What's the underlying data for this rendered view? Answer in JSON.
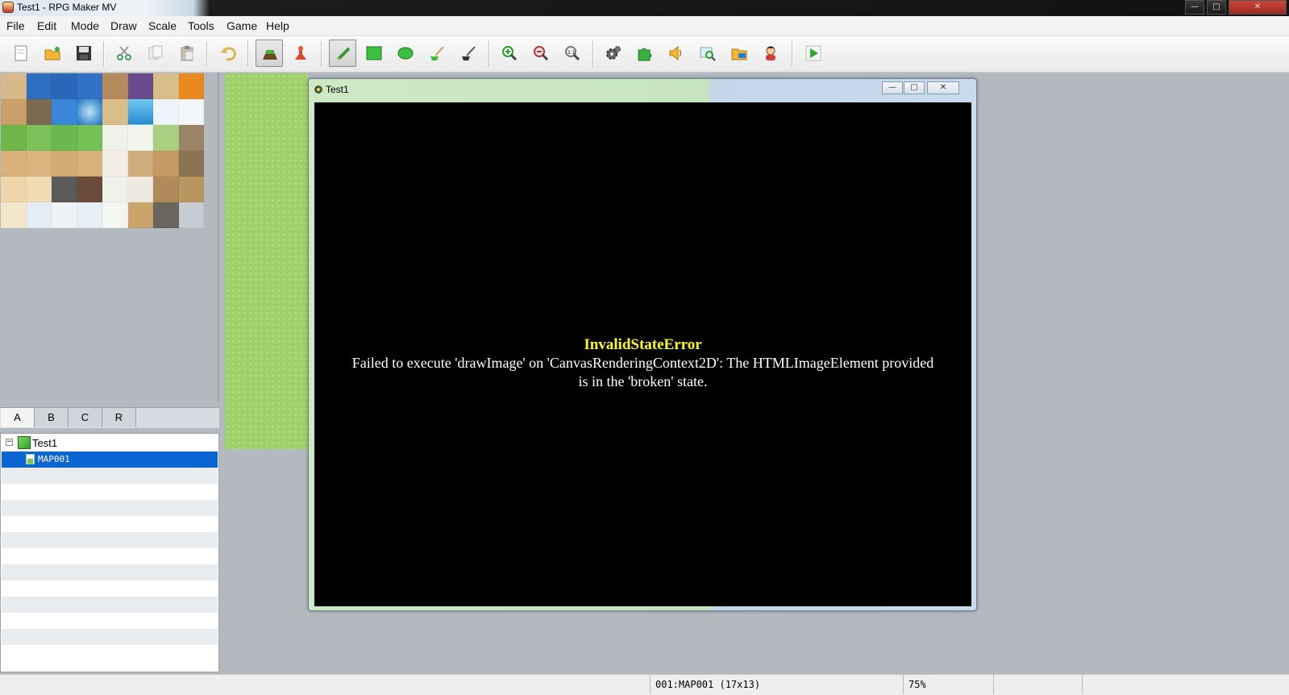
{
  "window": {
    "title": "Test1 - RPG Maker MV",
    "icon": "rpgmaker-app-icon"
  },
  "menu": [
    "File",
    "Edit",
    "Mode",
    "Draw",
    "Scale",
    "Tools",
    "Game",
    "Help"
  ],
  "toolbar": {
    "buttons": [
      {
        "name": "new-project-icon"
      },
      {
        "name": "open-project-icon"
      },
      {
        "name": "save-project-icon"
      },
      {
        "name": "cut-icon"
      },
      {
        "name": "copy-icon"
      },
      {
        "name": "paste-icon"
      },
      {
        "name": "undo-icon"
      },
      {
        "name": "map-mode-icon",
        "pressed": true
      },
      {
        "name": "event-mode-icon"
      },
      {
        "name": "pencil-icon",
        "pressed": true
      },
      {
        "name": "rectangle-icon"
      },
      {
        "name": "ellipse-icon"
      },
      {
        "name": "flood-fill-icon"
      },
      {
        "name": "shadow-pen-icon"
      },
      {
        "name": "zoom-in-icon"
      },
      {
        "name": "zoom-out-icon"
      },
      {
        "name": "actual-size-icon"
      },
      {
        "name": "database-icon"
      },
      {
        "name": "plugin-manager-icon"
      },
      {
        "name": "sound-test-icon"
      },
      {
        "name": "event-searcher-icon"
      },
      {
        "name": "resource-manager-icon"
      },
      {
        "name": "character-generator-icon"
      },
      {
        "name": "playtest-icon"
      }
    ]
  },
  "tileset_tabs": [
    "A",
    "B",
    "C",
    "R"
  ],
  "active_tab": "A",
  "map_tree": {
    "project": "Test1",
    "maps": [
      "MAP001"
    ],
    "selected": "MAP001"
  },
  "game_window": {
    "title": "Test1",
    "error_title": "InvalidStateError",
    "error_message": "Failed to execute 'drawImage' on 'CanvasRenderingContext2D': The HTMLImageElement provided is in the 'broken' state."
  },
  "status": {
    "map_info": "001:MAP001 (17x13)",
    "zoom": "75%"
  },
  "colors": {
    "error_title": "#ffff00",
    "error_text": "#ffffff",
    "selected_row": "#0a64d2",
    "grass": "#9fd06a"
  }
}
